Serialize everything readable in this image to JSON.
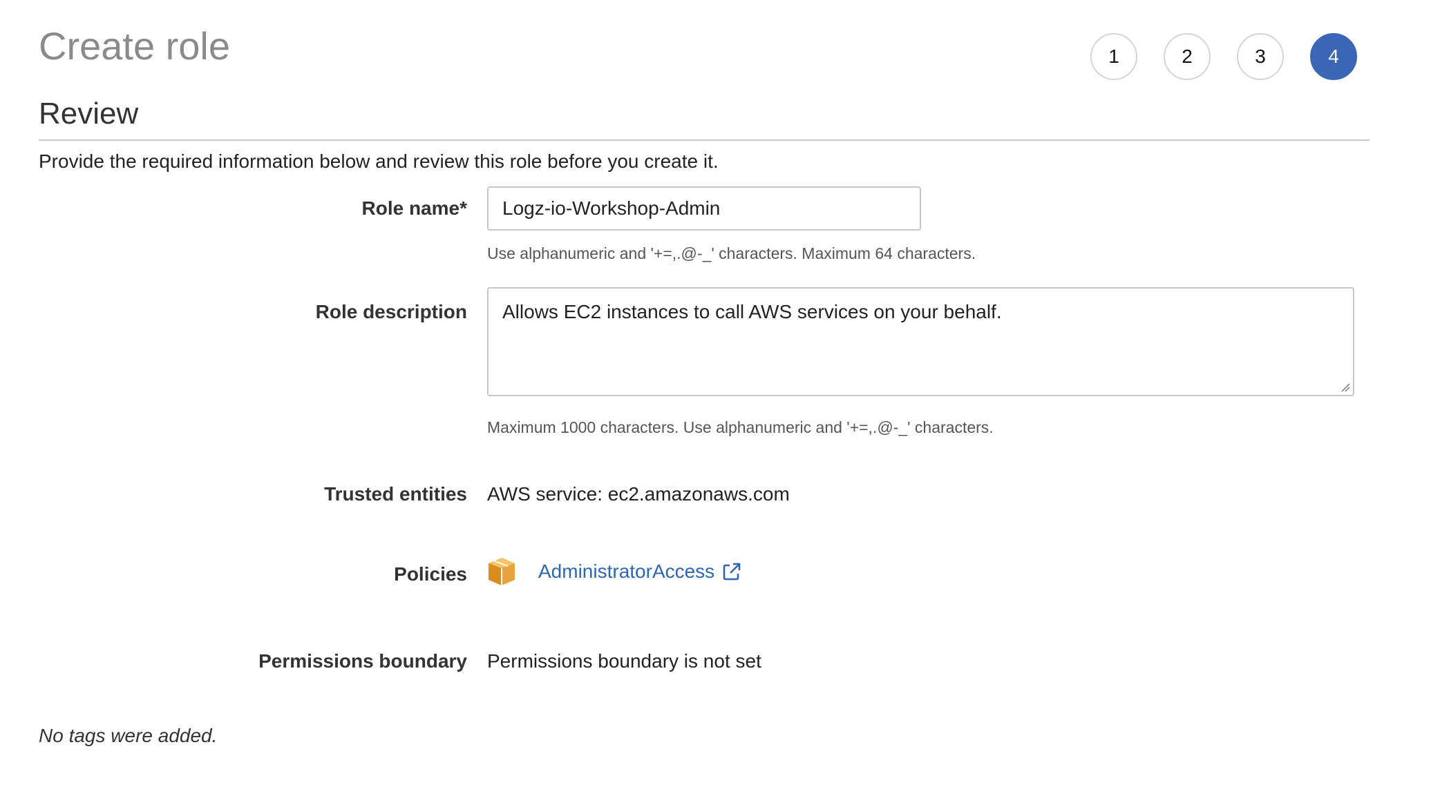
{
  "header": {
    "title": "Create role",
    "steps": [
      "1",
      "2",
      "3",
      "4"
    ],
    "active_step": "4"
  },
  "section": {
    "title": "Review",
    "intro": "Provide the required information below and review this role before you create it."
  },
  "form": {
    "role_name": {
      "label": "Role name*",
      "value": "Logz-io-Workshop-Admin",
      "hint": "Use alphanumeric and '+=,.@-_' characters. Maximum 64 characters."
    },
    "role_description": {
      "label": "Role description",
      "value": "Allows EC2 instances to call AWS services on your behalf.",
      "hint": "Maximum 1000 characters. Use alphanumeric and '+=,.@-_' characters."
    },
    "trusted_entities": {
      "label": "Trusted entities",
      "value": "AWS service: ec2.amazonaws.com"
    },
    "policies": {
      "label": "Policies",
      "link_text": "AdministratorAccess",
      "icon": "aws-policy-box-icon"
    },
    "permissions_boundary": {
      "label": "Permissions boundary",
      "value": "Permissions boundary is not set"
    }
  },
  "tags_note": "No tags were added.",
  "colors": {
    "active_step": "#3b65b5",
    "link": "#2f66b3",
    "title_gray": "#8a8a8a",
    "policy_icon": "#e8a33d"
  }
}
